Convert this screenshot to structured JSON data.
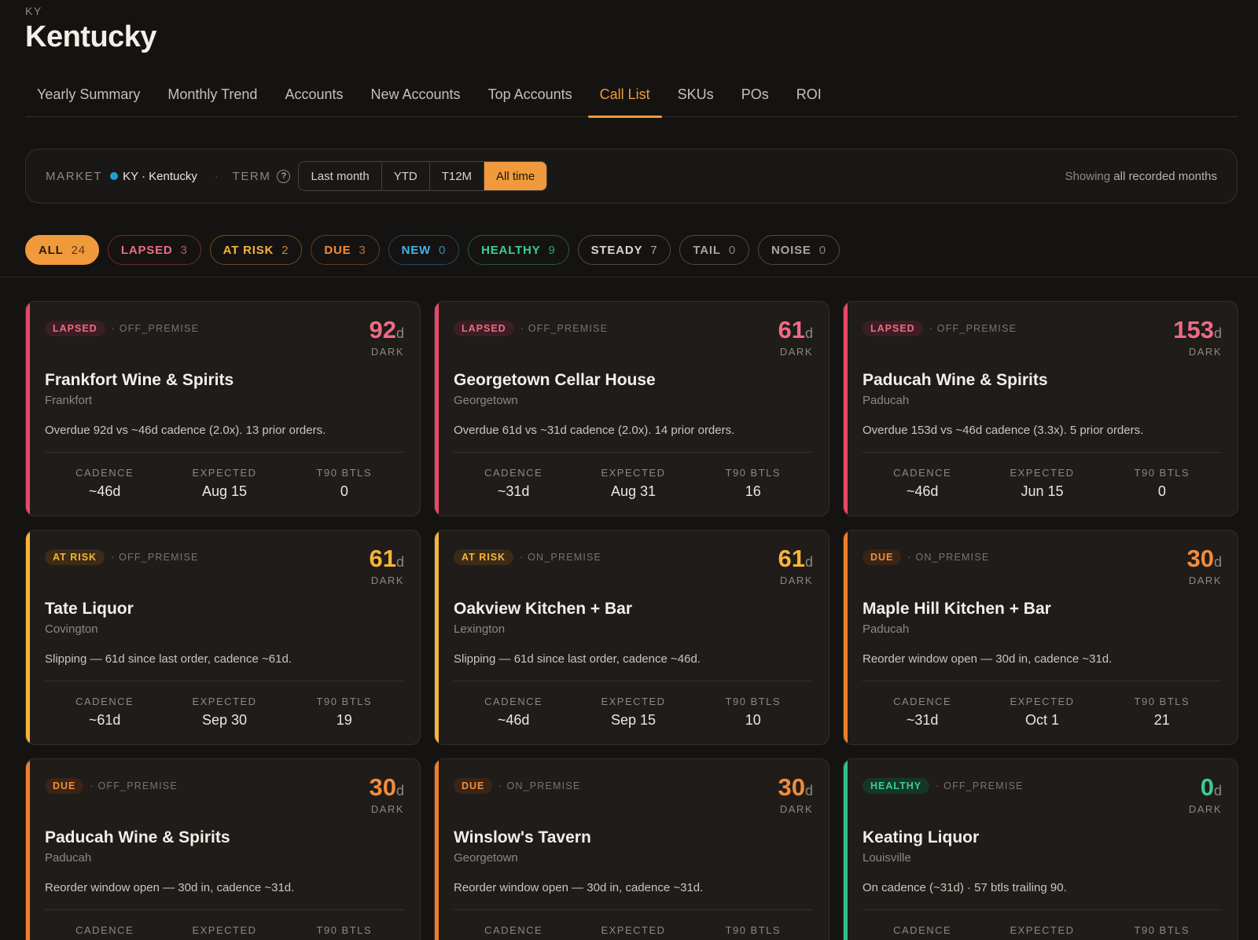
{
  "header": {
    "state_code": "KY",
    "state_name": "Kentucky"
  },
  "tabs": [
    {
      "label": "Yearly Summary"
    },
    {
      "label": "Monthly Trend"
    },
    {
      "label": "Accounts"
    },
    {
      "label": "New Accounts"
    },
    {
      "label": "Top Accounts"
    },
    {
      "label": "Call List",
      "active": true
    },
    {
      "label": "SKUs"
    },
    {
      "label": "POs"
    },
    {
      "label": "ROI"
    }
  ],
  "filters": {
    "market_label": "MARKET",
    "market_value": "KY · Kentucky",
    "separator": "·",
    "term_label": "TERM",
    "help_glyph": "?",
    "term_options": [
      "Last month",
      "YTD",
      "T12M",
      "All time"
    ],
    "term_selected": "All time",
    "showing_prefix": "Showing",
    "showing_value": "all recorded months",
    "colors": {
      "accent": "#f09a3c",
      "market_dot": "#1ea0d4"
    }
  },
  "pills": [
    {
      "label": "ALL",
      "count": "24",
      "key": "all",
      "active": true
    },
    {
      "label": "LAPSED",
      "count": "3",
      "key": "lapsed"
    },
    {
      "label": "AT RISK",
      "count": "2",
      "key": "atrisk"
    },
    {
      "label": "DUE",
      "count": "3",
      "key": "due"
    },
    {
      "label": "NEW",
      "count": "0",
      "key": "new"
    },
    {
      "label": "HEALTHY",
      "count": "9",
      "key": "healthy"
    },
    {
      "label": "STEADY",
      "count": "7",
      "key": "steady"
    },
    {
      "label": "TAIL",
      "count": "0",
      "key": "tail"
    },
    {
      "label": "NOISE",
      "count": "0",
      "key": "noise"
    }
  ],
  "status_colors": {
    "lapsed": "#e8486a",
    "atrisk": "#f7b43a",
    "due": "#f07f2c",
    "healthy": "#2fbf89"
  },
  "card_labels": {
    "dark": "DARK",
    "day_unit": "d",
    "cadence": "CADENCE",
    "expected": "EXPECTED",
    "t90": "T90 BTLS"
  },
  "cards": [
    {
      "status": "LAPSED",
      "key": "lapsed",
      "premise": "OFF_PREMISE",
      "days": "92",
      "name": "Frankfort Wine & Spirits",
      "city": "Frankfort",
      "note": "Overdue 92d vs ~46d cadence (2.0x). 13 prior orders.",
      "cadence": "~46d",
      "expected": "Aug 15",
      "t90": "0"
    },
    {
      "status": "LAPSED",
      "key": "lapsed",
      "premise": "OFF_PREMISE",
      "days": "61",
      "name": "Georgetown Cellar House",
      "city": "Georgetown",
      "note": "Overdue 61d vs ~31d cadence (2.0x). 14 prior orders.",
      "cadence": "~31d",
      "expected": "Aug 31",
      "t90": "16"
    },
    {
      "status": "LAPSED",
      "key": "lapsed",
      "premise": "OFF_PREMISE",
      "days": "153",
      "name": "Paducah Wine & Spirits",
      "city": "Paducah",
      "note": "Overdue 153d vs ~46d cadence (3.3x). 5 prior orders.",
      "cadence": "~46d",
      "expected": "Jun 15",
      "t90": "0"
    },
    {
      "status": "AT RISK",
      "key": "atrisk",
      "premise": "OFF_PREMISE",
      "days": "61",
      "name": "Tate Liquor",
      "city": "Covington",
      "note": "Slipping — 61d since last order, cadence ~61d.",
      "cadence": "~61d",
      "expected": "Sep 30",
      "t90": "19"
    },
    {
      "status": "AT RISK",
      "key": "atrisk",
      "premise": "ON_PREMISE",
      "days": "61",
      "name": "Oakview Kitchen + Bar",
      "city": "Lexington",
      "note": "Slipping — 61d since last order, cadence ~46d.",
      "cadence": "~46d",
      "expected": "Sep 15",
      "t90": "10"
    },
    {
      "status": "DUE",
      "key": "due",
      "premise": "ON_PREMISE",
      "days": "30",
      "name": "Maple Hill Kitchen + Bar",
      "city": "Paducah",
      "note": "Reorder window open — 30d in, cadence ~31d.",
      "cadence": "~31d",
      "expected": "Oct 1",
      "t90": "21"
    },
    {
      "status": "DUE",
      "key": "due",
      "premise": "OFF_PREMISE",
      "days": "30",
      "name": "Paducah Wine & Spirits",
      "city": "Paducah",
      "note": "Reorder window open — 30d in, cadence ~31d.",
      "cadence": "",
      "expected": "",
      "t90": ""
    },
    {
      "status": "DUE",
      "key": "due",
      "premise": "ON_PREMISE",
      "days": "30",
      "name": "Winslow's Tavern",
      "city": "Georgetown",
      "note": "Reorder window open — 30d in, cadence ~31d.",
      "cadence": "",
      "expected": "",
      "t90": ""
    },
    {
      "status": "HEALTHY",
      "key": "healthy",
      "premise": "OFF_PREMISE",
      "days": "0",
      "name": "Keating Liquor",
      "city": "Louisville",
      "note": "On cadence (~31d) · 57 btls trailing 90.",
      "cadence": "",
      "expected": "",
      "t90": ""
    }
  ]
}
